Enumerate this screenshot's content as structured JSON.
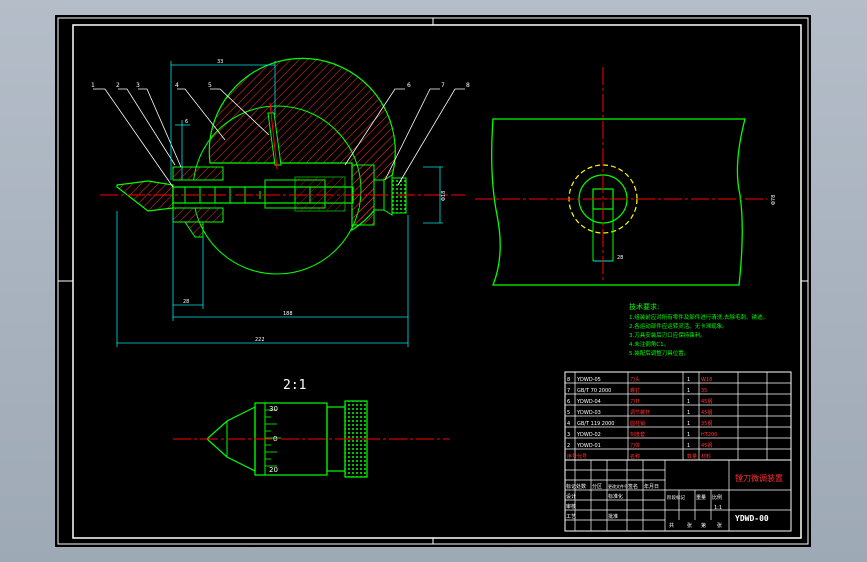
{
  "drawing": {
    "scale_label": "2:1",
    "notes_heading": "技术要求:",
    "notes_lines": [
      "1.组装前应对所有零件及部件进行清洗,去除毛刺、锈迹。",
      "2.各运动部件应运转灵活、无卡滞现象。",
      "3.刀具安装后刃口应保持锋利。",
      "4.未注倒角C1。",
      "5.装配后调整刀具位置。"
    ],
    "part_labels": [
      "1",
      "2",
      "3",
      "4",
      "5",
      "6",
      "7",
      "8"
    ],
    "dim_labels": {
      "top": "33",
      "left_small": "6",
      "right_dia": "Φ18",
      "bottom1": "28",
      "bottom2": "188",
      "bottom3": "222",
      "side_view_right": "Φ78",
      "side_view_small": "28",
      "scale_top": "30",
      "scale_mid": "0",
      "scale_bottom": "20"
    }
  },
  "parts_list": {
    "rows": [
      {
        "no": "8",
        "code": "YDWD-05",
        "name": "刀头",
        "qty": "1",
        "material": "W18"
      },
      {
        "no": "7",
        "code": "GB/T 70 2000",
        "name": "螺钉",
        "qty": "1",
        "material": "35"
      },
      {
        "no": "6",
        "code": "YDWD-04",
        "name": "刀杆",
        "qty": "1",
        "material": "45钢"
      },
      {
        "no": "5",
        "code": "YDWD-03",
        "name": "调节螺杆",
        "qty": "1",
        "material": "45钢"
      },
      {
        "no": "4",
        "code": "GB/T 119 2000",
        "name": "圆柱销",
        "qty": "1",
        "material": "35钢"
      },
      {
        "no": "3",
        "code": "YDWD-02",
        "name": "刻度套",
        "qty": "1",
        "material": "HT200"
      },
      {
        "no": "2",
        "code": "YDWD-01",
        "name": "刀体",
        "qty": "1",
        "material": "45钢"
      }
    ],
    "header": {
      "no": "序号",
      "code": "代号",
      "name": "名称",
      "qty": "数量",
      "material": "材料"
    }
  },
  "title_block": {
    "title": "镗刀微调装置",
    "drawing_no": "YDWD-00",
    "scale_header": "比例",
    "row_labels": [
      "标记",
      "处数",
      "分区",
      "更改文件号",
      "签名",
      "年月日"
    ],
    "role_labels": [
      "设计",
      "审核",
      "工艺",
      "批准"
    ],
    "std_label": "标准化",
    "sheet_labels": [
      "共",
      "张",
      "第",
      "张"
    ],
    "stage_labels": [
      "阶段标记",
      "重量",
      "比例"
    ],
    "scale_value": "1:1"
  },
  "colors": {
    "background": "#000000",
    "frame": "#ffffff",
    "outline": "#00ff00",
    "centerline": "#ff0000",
    "dimension": "#00e5e5",
    "hatch": "#ff3030",
    "text": "#ffffff",
    "gear": "#ffff00"
  }
}
